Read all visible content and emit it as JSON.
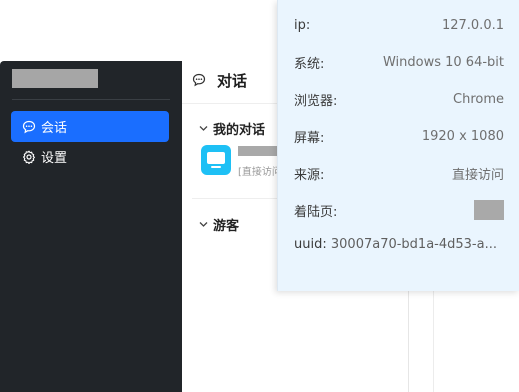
{
  "sidebar": {
    "items": [
      {
        "label": "会话",
        "icon": "chat-bubble-icon",
        "active": true
      },
      {
        "label": "设置",
        "icon": "gear-icon",
        "active": false
      }
    ]
  },
  "conversations": {
    "title": "对话",
    "groups": [
      {
        "label": "我的对话",
        "expanded": true,
        "items": [
          {
            "snippet": "[直接访问",
            "avatar": "desktop-icon"
          }
        ]
      },
      {
        "label": "游客",
        "expanded": true,
        "items": []
      }
    ]
  },
  "visitor_info": {
    "rows": [
      {
        "label": "ip:",
        "value": "127.0.0.1"
      },
      {
        "label": "系统:",
        "value": "Windows 10 64-bit"
      },
      {
        "label": "浏览器:",
        "value": "Chrome"
      },
      {
        "label": "屏幕:",
        "value": "1920 x 1080"
      },
      {
        "label": "来源:",
        "value": "直接访问"
      },
      {
        "label": "着陆页:",
        "value": ""
      }
    ],
    "uuid_label": "uuid:",
    "uuid_value": "30007a70-bd1a-4d53-a..."
  },
  "colors": {
    "sidebar_bg": "#212529",
    "active_item": "#1a6eff",
    "popover_bg": "#eaf5fe",
    "avatar": "#1ec0f5"
  }
}
